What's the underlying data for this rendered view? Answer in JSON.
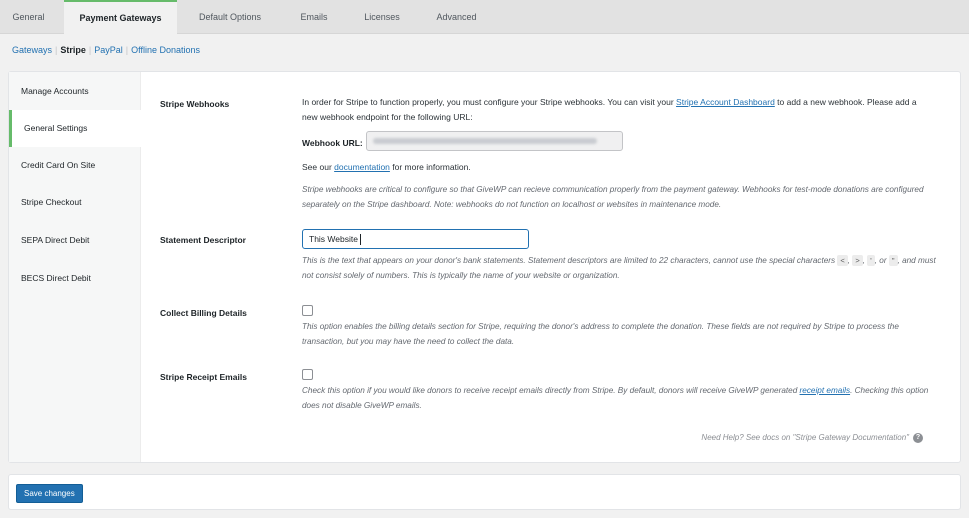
{
  "tabs": [
    {
      "label": "General"
    },
    {
      "label": "Payment Gateways"
    },
    {
      "label": "Default Options"
    },
    {
      "label": "Emails"
    },
    {
      "label": "Licenses"
    },
    {
      "label": "Advanced"
    }
  ],
  "subnav": {
    "gateways": "Gateways",
    "stripe": "Stripe",
    "paypal": "PayPal",
    "offline": "Offline Donations",
    "separator": "|"
  },
  "sidebar": {
    "items": [
      {
        "label": "Manage Accounts"
      },
      {
        "label": "General Settings"
      },
      {
        "label": "Credit Card On Site"
      },
      {
        "label": "Stripe Checkout"
      },
      {
        "label": "SEPA Direct Debit"
      },
      {
        "label": "BECS Direct Debit"
      }
    ]
  },
  "webhooks": {
    "label": "Stripe Webhooks",
    "intro_1": "In order for Stripe to function properly, you must configure your Stripe webhooks. You can visit your ",
    "intro_link": "Stripe Account Dashboard",
    "intro_2": " to add a new webhook. Please add a new webhook endpoint for the following URL:",
    "url_label": "Webhook URL:",
    "see_1": "See our ",
    "see_link": "documentation",
    "see_2": " for more information.",
    "note": "Stripe webhooks are critical to configure so that GiveWP can recieve communication properly from the payment gateway. Webhooks for test-mode donations are configured separately on the Stripe dashboard. Note: webhooks do not function on localhost or websites in maintenance mode."
  },
  "descriptor": {
    "label": "Statement Descriptor",
    "value": "This Website",
    "desc_1": "This is the text that appears on your donor's bank statements. Statement descriptors are limited to 22 characters, cannot use the special characters ",
    "char_lt": "<",
    "char_gt": ">",
    "char_sq": "'",
    "char_dq": "\"",
    "desc_2": ", or ",
    "desc_3": ", and must not consist solely of numbers. This is typically the name of your website or organization."
  },
  "billing": {
    "label": "Collect Billing Details",
    "desc": "This option enables the billing details section for Stripe, requiring the donor's address to complete the donation. These fields are not required by Stripe to process the transaction, but you may have the need to collect the data."
  },
  "receipt": {
    "label": "Stripe Receipt Emails",
    "desc_1": "Check this option if you would like donors to receive receipt emails directly from Stripe. By default, donors will receive GiveWP generated ",
    "desc_link": "receipt emails",
    "desc_2": ". Checking this option does not disable GiveWP emails."
  },
  "help": {
    "text": "Need Help? See docs on \"Stripe Gateway Documentation\"",
    "icon": "?"
  },
  "footer": {
    "save_label": "Save changes"
  },
  "colors": {
    "accent": "#66bb6a",
    "link": "#2271b1",
    "button": "#2271b1"
  }
}
